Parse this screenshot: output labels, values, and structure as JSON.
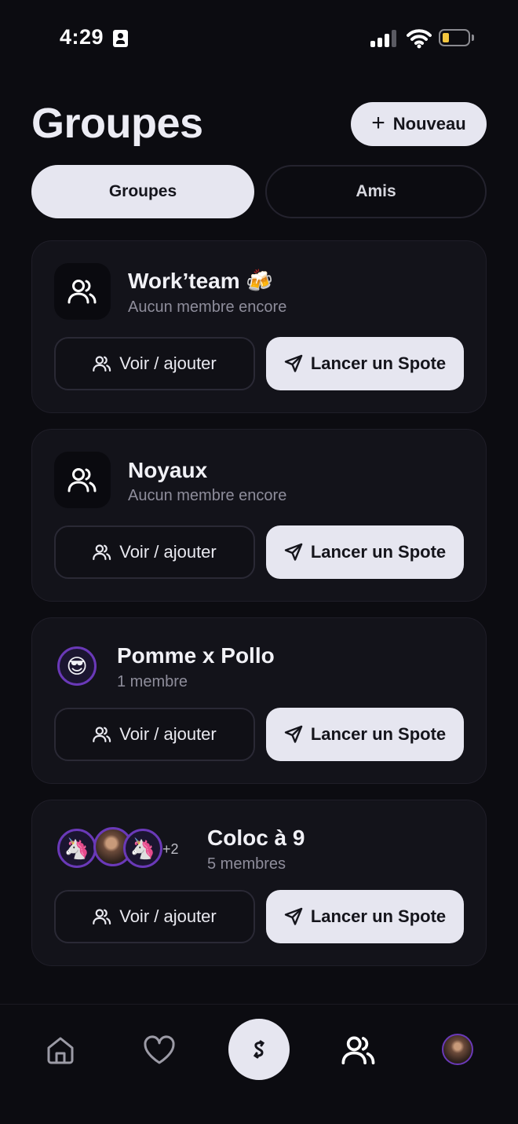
{
  "status_bar": {
    "time": "4:29"
  },
  "header": {
    "title": "Groupes",
    "new_button": "Nouveau"
  },
  "tabs": [
    {
      "label": "Groupes",
      "active": true
    },
    {
      "label": "Amis",
      "active": false
    }
  ],
  "groups": [
    {
      "name": "Work’team 🍻",
      "subtitle": "Aucun membre encore",
      "view_label": "Voir / ajouter",
      "launch_label": "Lancer un Spote"
    },
    {
      "name": "Noyaux",
      "subtitle": "Aucun membre encore",
      "view_label": "Voir / ajouter",
      "launch_label": "Lancer un Spote"
    },
    {
      "name": "Pomme x Pollo",
      "subtitle": "1 membre",
      "avatar_emoji": "😎",
      "view_label": "Voir / ajouter",
      "launch_label": "Lancer un Spote"
    },
    {
      "name": "Coloc à 9",
      "subtitle": "5 membres",
      "avatar_emoji": "🦄",
      "extra_count": "+2",
      "view_label": "Voir / ajouter",
      "launch_label": "Lancer un Spote"
    }
  ],
  "nav": {
    "items": [
      "home-icon",
      "heart-icon",
      "spote-icon",
      "groups-icon",
      "profile-avatar"
    ],
    "active": "groups-icon"
  },
  "colors": {
    "background": "#0c0c11",
    "card": "#13131a",
    "accent_light": "#e6e6f0",
    "avatar_ring": "#6a39b8"
  }
}
